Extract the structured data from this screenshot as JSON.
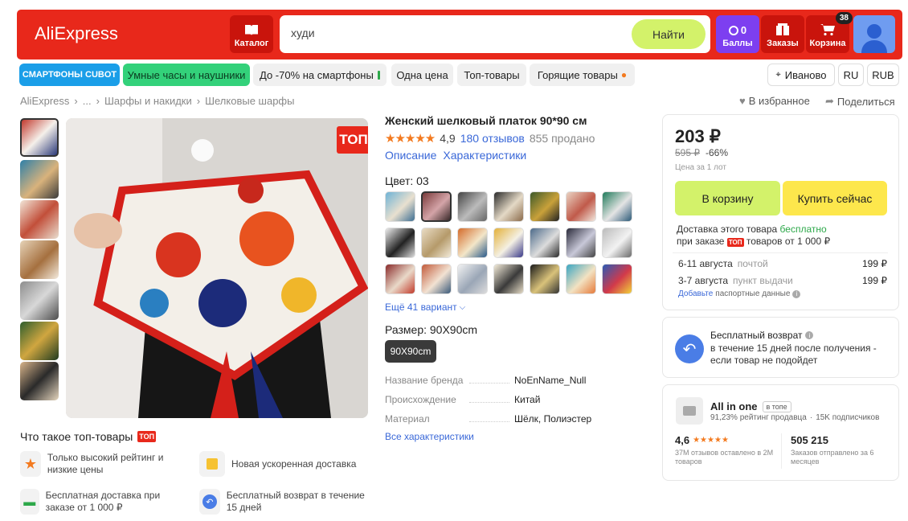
{
  "header": {
    "logo": "AliExpress",
    "catalog_label": "Каталог",
    "search_value": "худи",
    "search_button": "Найти",
    "points_count": "0",
    "points_label": "Баллы",
    "orders_label": "Заказы",
    "cart_label": "Корзина",
    "cart_badge": "38"
  },
  "nav": {
    "chips": [
      "СМАРТФОНЫ CUBOT",
      "Умные часы и наушники",
      "До -70% на смартфоны",
      "Одна цена",
      "Топ-товары",
      "Горящие товары"
    ],
    "location": "Иваново",
    "lang": "RU",
    "currency": "RUB"
  },
  "breadcrumb": [
    "AliExpress",
    "...",
    "Шарфы и накидки",
    "Шелковые шарфы"
  ],
  "actions": {
    "favorite": "В избранное",
    "share": "Поделиться"
  },
  "badge": {
    "top": "ТОП"
  },
  "product": {
    "title": "Женский шелковый платок 90*90 см",
    "rating": "4,9",
    "reviews": "180 отзывов",
    "sold": "855 продано",
    "tab_description": "Описание",
    "tab_specs": "Характеристики",
    "color_label": "Цвет: 03",
    "more_variants": "Ещё 41 вариант",
    "size_label": "Размер: 90X90cm",
    "size_option": "90X90cm",
    "specs": [
      {
        "name": "Название бренда",
        "value": "NoEnName_Null"
      },
      {
        "name": "Происхождение",
        "value": "Китай"
      },
      {
        "name": "Материал",
        "value": "Шёлк, Полиэстер"
      }
    ],
    "all_specs": "Все характеристики"
  },
  "top_info": {
    "title": "Что такое топ-товары",
    "items": [
      "Только высокий рейтинг и низкие цены",
      "Новая ускоренная доставка",
      "Бесплатная доставка при заказе от 1 000 ₽",
      "Бесплатный возврат в течение 15 дней"
    ]
  },
  "price_card": {
    "price": "203 ₽",
    "old_price": "595 ₽",
    "discount": "-66%",
    "per_lot": "Цена за 1 лот",
    "add_to_cart": "В корзину",
    "buy_now": "Купить сейчас",
    "delivery_1": "Доставка этого товара",
    "delivery_free": "бесплатно",
    "delivery_2": "при заказе",
    "delivery_3": "товаров от 1 000 ₽",
    "option1_date": "6-11 августа",
    "option1_method": "почтой",
    "option1_price": "199 ₽",
    "option2_date": "3-7 августа",
    "option2_method": "пункт выдачи",
    "option2_price": "199 ₽",
    "passport_link": "Добавьте",
    "passport_text": "паспортные данные"
  },
  "return_card": {
    "title": "Бесплатный возврат",
    "text": "в течение 15 дней после получения - если товар не подойдет"
  },
  "seller": {
    "name": "All in one",
    "tag": "в топе",
    "rating_text": "91,23% рейтинг продавца",
    "subscribers": "15K подписчиков",
    "score": "4,6",
    "score_sub": "37M отзывов оставлено в 2M товаров",
    "orders": "505 215",
    "orders_sub": "Заказов отправлено за 6 месяцев"
  },
  "colors": {
    "brand": "#e8281b",
    "lime": "#d3f26a",
    "yellow": "#fde74c",
    "purple": "#7d3ff0",
    "link": "#3a68d8",
    "green": "#2da84a"
  }
}
